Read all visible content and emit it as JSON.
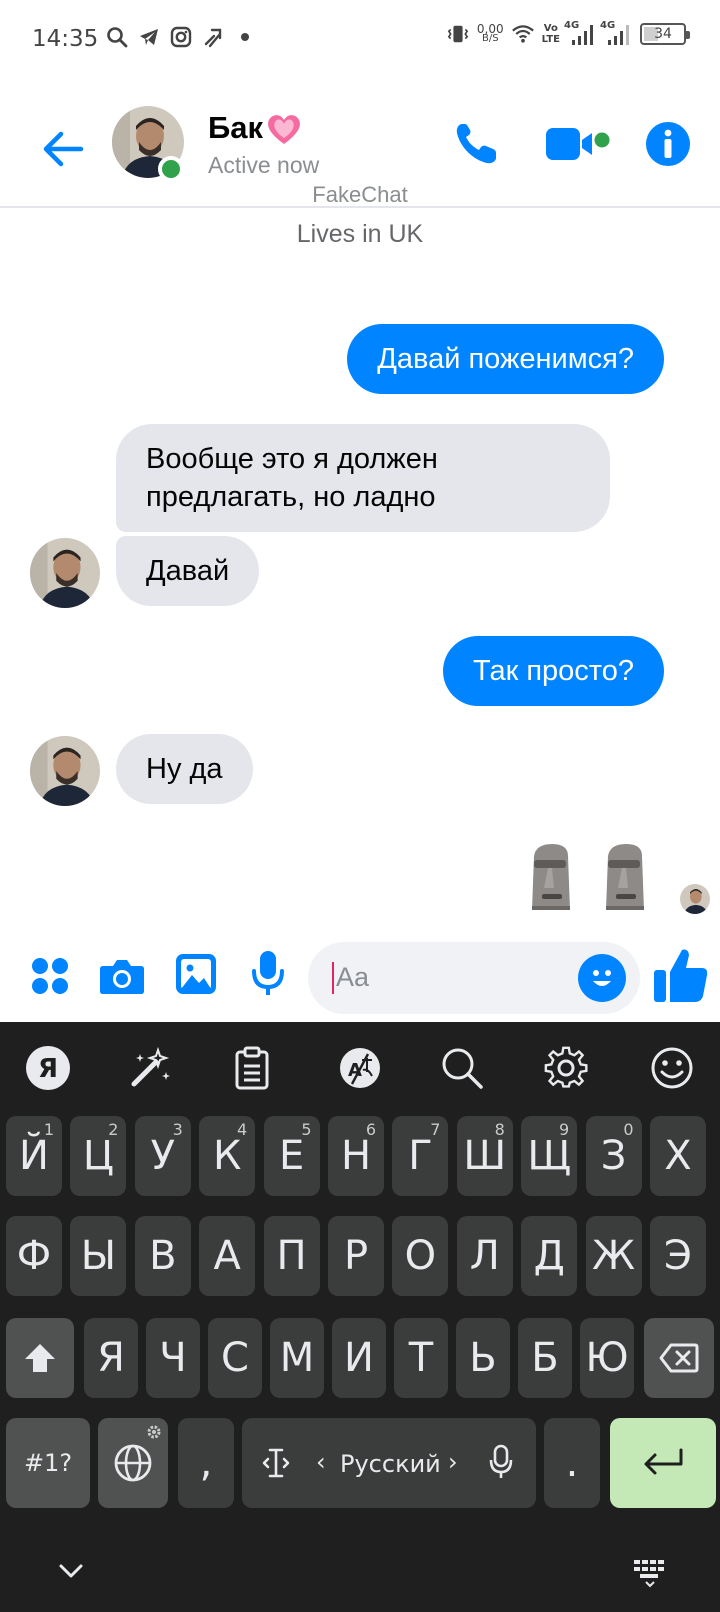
{
  "status_bar": {
    "time": "14:35",
    "network_speed_value": "0,00",
    "network_speed_unit": "B/S",
    "volte_line1": "Vo",
    "volte_line2": "LTE",
    "net1": "4G",
    "net2": "4G",
    "battery": "34",
    "icons": [
      "search-icon",
      "telegram-icon",
      "instagram-icon",
      "lightning-icon",
      "dot-icon",
      "vibrate-icon",
      "wifi-icon",
      "signal-icon",
      "battery-icon"
    ]
  },
  "header": {
    "contact_name": "Бак",
    "presence": "Active now",
    "watermark": "FakeChat",
    "info_line": "Lives in UK",
    "accent": "#0084ff"
  },
  "messages": [
    {
      "side": "out",
      "text": "Давай поженимся?"
    },
    {
      "side": "in",
      "line1": "Вообще это я должен",
      "line2": "предлагать, но ладно"
    },
    {
      "side": "in",
      "text": "Давай"
    },
    {
      "side": "out",
      "text": "Так просто?"
    },
    {
      "side": "in",
      "text": "Ну да"
    },
    {
      "side": "out",
      "sticker": "moai-moai"
    }
  ],
  "composer": {
    "placeholder": "Aa"
  },
  "keyboard": {
    "row1": [
      {
        "key": "Й",
        "hint": "1"
      },
      {
        "key": "Ц",
        "hint": "2"
      },
      {
        "key": "У",
        "hint": "3"
      },
      {
        "key": "К",
        "hint": "4"
      },
      {
        "key": "Е",
        "hint": "5"
      },
      {
        "key": "Н",
        "hint": "6"
      },
      {
        "key": "Г",
        "hint": "7"
      },
      {
        "key": "Ш",
        "hint": "8"
      },
      {
        "key": "Щ",
        "hint": "9"
      },
      {
        "key": "З",
        "hint": "0"
      },
      {
        "key": "Х",
        "hint": ""
      }
    ],
    "row2": [
      "Ф",
      "Ы",
      "В",
      "А",
      "П",
      "Р",
      "О",
      "Л",
      "Д",
      "Ж",
      "Э"
    ],
    "row3": [
      "Я",
      "Ч",
      "С",
      "М",
      "И",
      "Т",
      "Ь",
      "Б",
      "Ю"
    ],
    "symbols_key": "#1?",
    "comma_key": ",",
    "period_key": ".",
    "space_label": "Русский",
    "space_left": "‹",
    "space_right": "›",
    "enter_color": "#c5e8b7"
  }
}
